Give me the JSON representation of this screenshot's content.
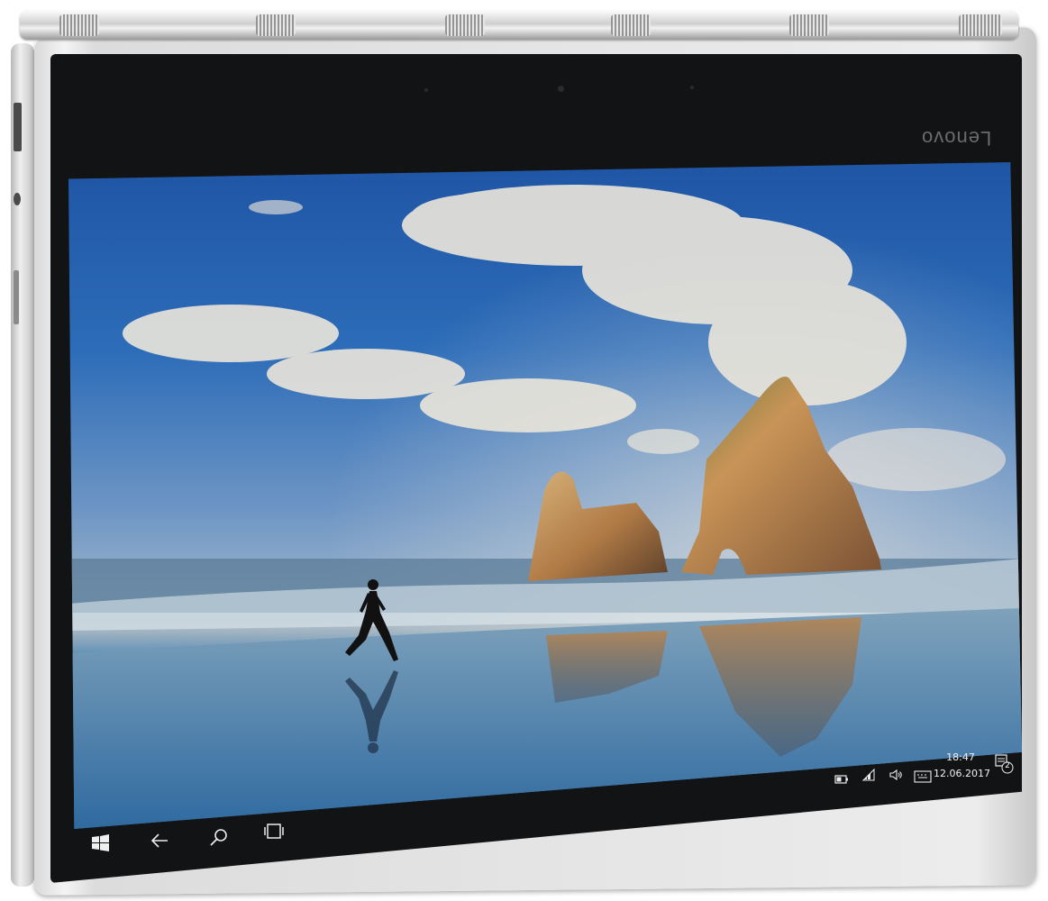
{
  "device": {
    "brand": "Lenovo",
    "frame_color": "#d6d6d6",
    "bezel_color": "#121314"
  },
  "desktop": {
    "wallpaper": "windows-10-hero-beach",
    "sky_color": "#2c6cb8",
    "sea_color": "#2f6392"
  },
  "taskbar": {
    "start_icon": "windows-logo-icon",
    "back_icon": "back-arrow-icon",
    "search_icon": "search-icon",
    "task_view_icon": "task-view-icon"
  },
  "tray": {
    "battery_icon": "battery-icon",
    "wifi_icon": "wifi-icon",
    "volume_icon": "volume-icon",
    "keyboard_icon": "touch-keyboard-icon",
    "time": "18:47",
    "date": "12.06.2017",
    "notification_icon": "action-center-icon",
    "notification_count": "2"
  }
}
